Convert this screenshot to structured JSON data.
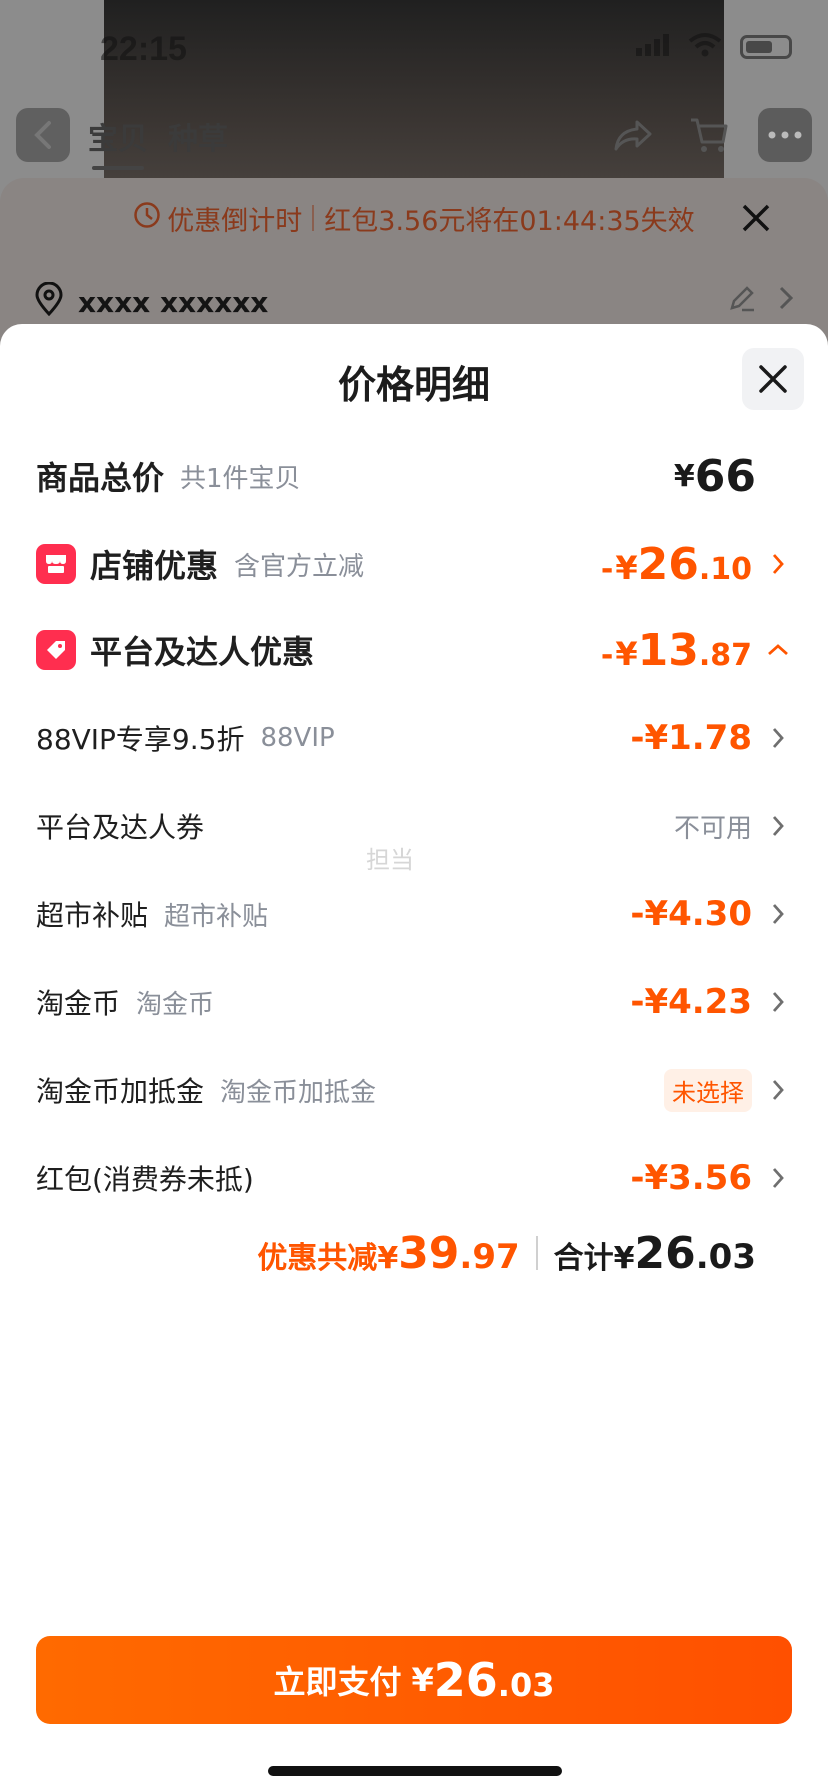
{
  "status_bar": {
    "time": "22:15"
  },
  "nav": {
    "tabs": [
      "宝贝",
      "种草"
    ]
  },
  "countdown": {
    "label": "优惠倒计时",
    "message": "红包3.56元将在01:44:35失效"
  },
  "address": {
    "text": "xxxx xxxxxx"
  },
  "sheet": {
    "title": "价格明细",
    "watermark": "担当",
    "rows": {
      "goods_total": {
        "label": "商品总价",
        "sub": "共1件宝贝",
        "yen": "¥",
        "value": "66"
      },
      "shop_discount": {
        "label": "店铺优惠",
        "sub": "含官方立减",
        "minus": "-",
        "yen": "¥",
        "int": "26",
        "dec": ".10"
      },
      "platform_discount": {
        "label": "平台及达人优惠",
        "minus": "-",
        "yen": "¥",
        "int": "13",
        "dec": ".87"
      },
      "vip": {
        "label": "88VIP专享9.5折",
        "sub": "88VIP",
        "amount": "-¥1.78"
      },
      "coupon": {
        "label": "平台及达人券",
        "status": "不可用"
      },
      "supermarket": {
        "label": "超市补贴",
        "sub": "超市补贴",
        "amount": "-¥4.30"
      },
      "taojinbi": {
        "label": "淘金币",
        "sub": "淘金币",
        "amount": "-¥4.23"
      },
      "taojinbi_extra": {
        "label": "淘金币加抵金",
        "sub": "淘金币加抵金",
        "status": "未选择"
      },
      "hongbao": {
        "label": "红包(消费券未抵)",
        "amount": "-¥3.56"
      }
    },
    "totals": {
      "discount_label": "优惠共减",
      "discount_yen": "¥",
      "discount_int": "39",
      "discount_dec": ".97",
      "total_label": "合计",
      "total_yen": "¥",
      "total_int": "26",
      "total_dec": ".03"
    },
    "pay_button": {
      "label": "立即支付",
      "yen": "¥",
      "int": "26",
      "dec": ".03"
    }
  },
  "colors": {
    "accent": "#ff5500",
    "badge": "#ff2e4f",
    "text_muted": "#8a8f99"
  }
}
